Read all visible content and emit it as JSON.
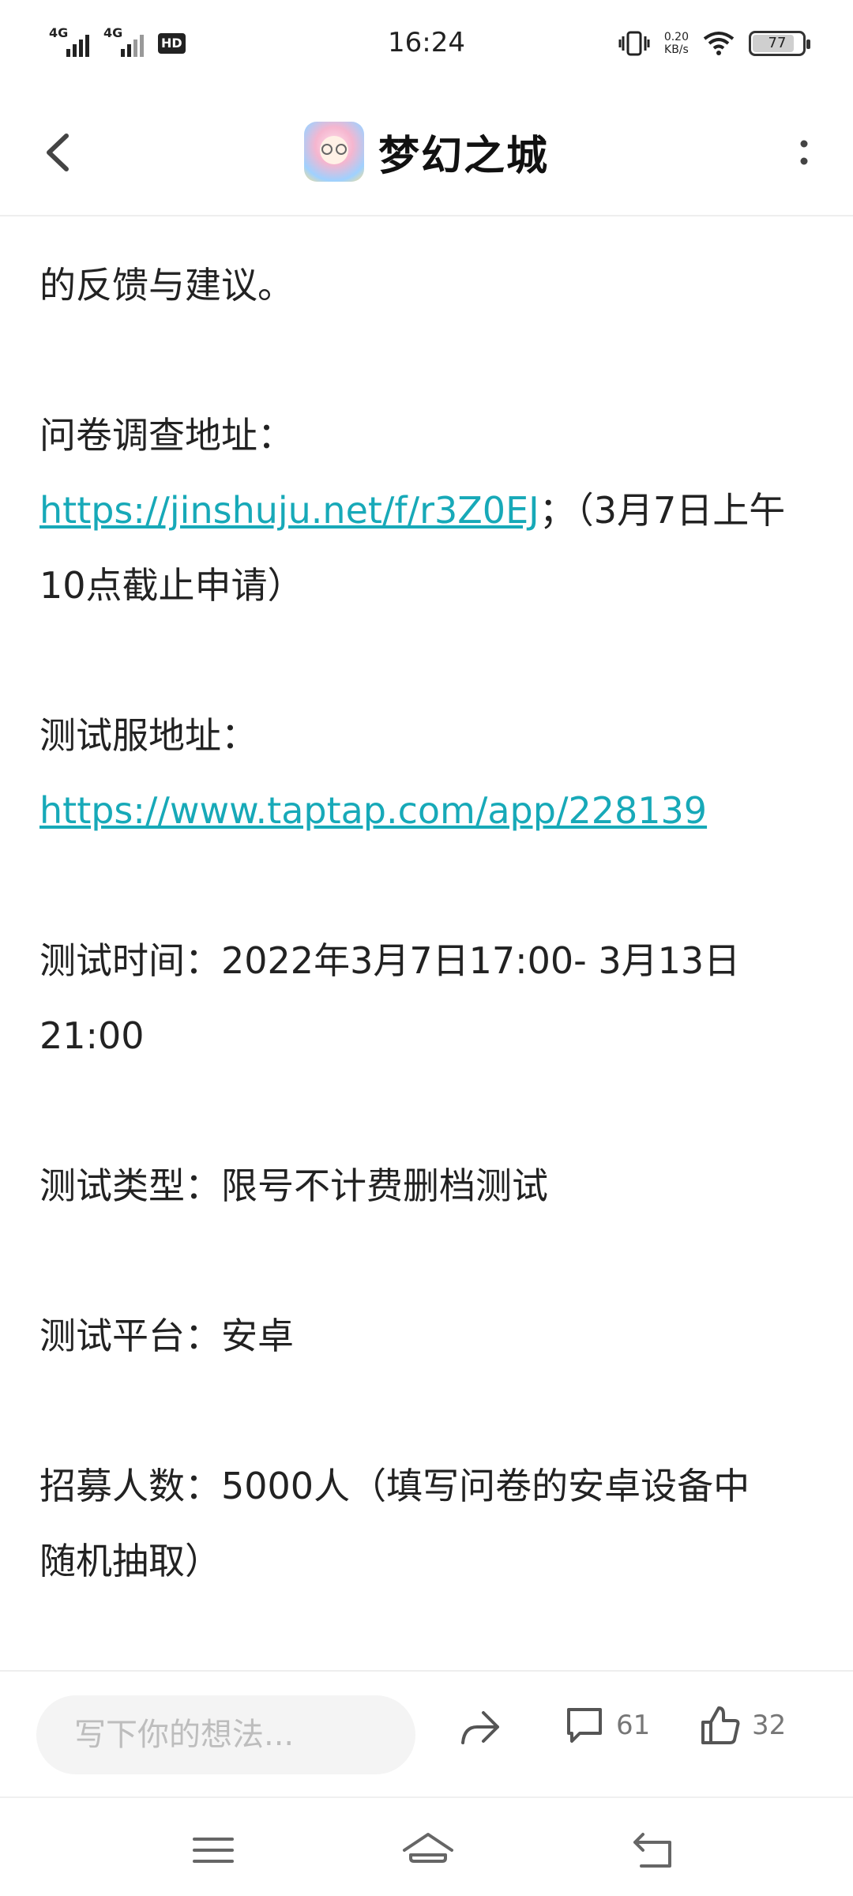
{
  "status_bar": {
    "time": "16:24",
    "signal1_label": "4G",
    "signal2_label": "4G",
    "hd_label": "HD",
    "net_speed_value": "0.20",
    "net_speed_unit": "KB/s",
    "battery": "77"
  },
  "header": {
    "title": "梦幻之城",
    "back_icon": "chevron-left-icon",
    "more_icon": "more-vertical-icon"
  },
  "article": {
    "cut_line": "的反馈与建议。",
    "survey_label": "问卷调查地址：",
    "survey_link": "https://jinshuju.net/f/r3Z0EJ",
    "survey_note_1": "；（3月7日上午",
    "survey_note_2": "10点截止申请）",
    "server_label": "测试服地址：",
    "server_link": "https://www.taptap.com/app/228139",
    "time_line_1": "测试时间：2022年3月7日17:00- 3月13日",
    "time_line_2": "21:00",
    "type_line": "测试类型：限号不计费删档测试",
    "platform_line": "测试平台：安卓",
    "recruit_line_1": "招募人数：5000人（填写问卷的安卓设备中",
    "recruit_line_2": "随机抽取）"
  },
  "bottom_bar": {
    "comment_placeholder": "写下你的想法...",
    "comment_count": "61",
    "like_count": "32"
  },
  "colors": {
    "link": "#17a9b8",
    "text": "#222222",
    "input_bg": "#f4f4f4"
  }
}
